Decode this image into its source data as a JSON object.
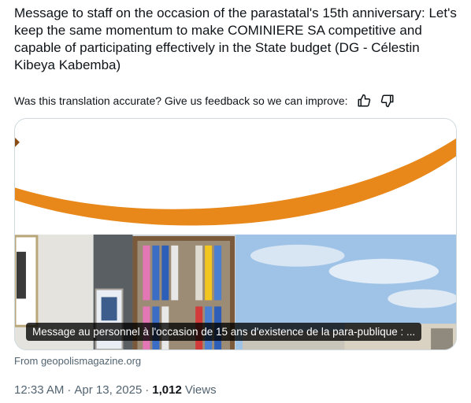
{
  "tweet": {
    "text": "Message to staff on the occasion of the parastatal's 15th anniversary: Let's keep the same momentum to make COMINIERE SA competitive and capable of participating effectively in the State budget (DG - Célestin Kibeya Kabemba)"
  },
  "feedback": {
    "prompt": "Was this translation accurate? Give us feedback so we can improve:",
    "thumbs_up_icon": "thumbs-up-icon",
    "thumbs_down_icon": "thumbs-down-icon"
  },
  "link_card": {
    "caption": "Message au personnel à l'occasion de 15 ans d'existence de la para-publique : ...",
    "source": "From geopolismagazine.org"
  },
  "meta": {
    "time": "12:33 AM",
    "separator1": "·",
    "date": "Apr 13, 2025",
    "separator2": "·",
    "views_count": "1,012",
    "views_label": "Views"
  },
  "colors": {
    "accent_orange": "#e8881a",
    "text_primary": "#0f1419",
    "text_secondary": "#536471",
    "border": "#cfd9de"
  }
}
